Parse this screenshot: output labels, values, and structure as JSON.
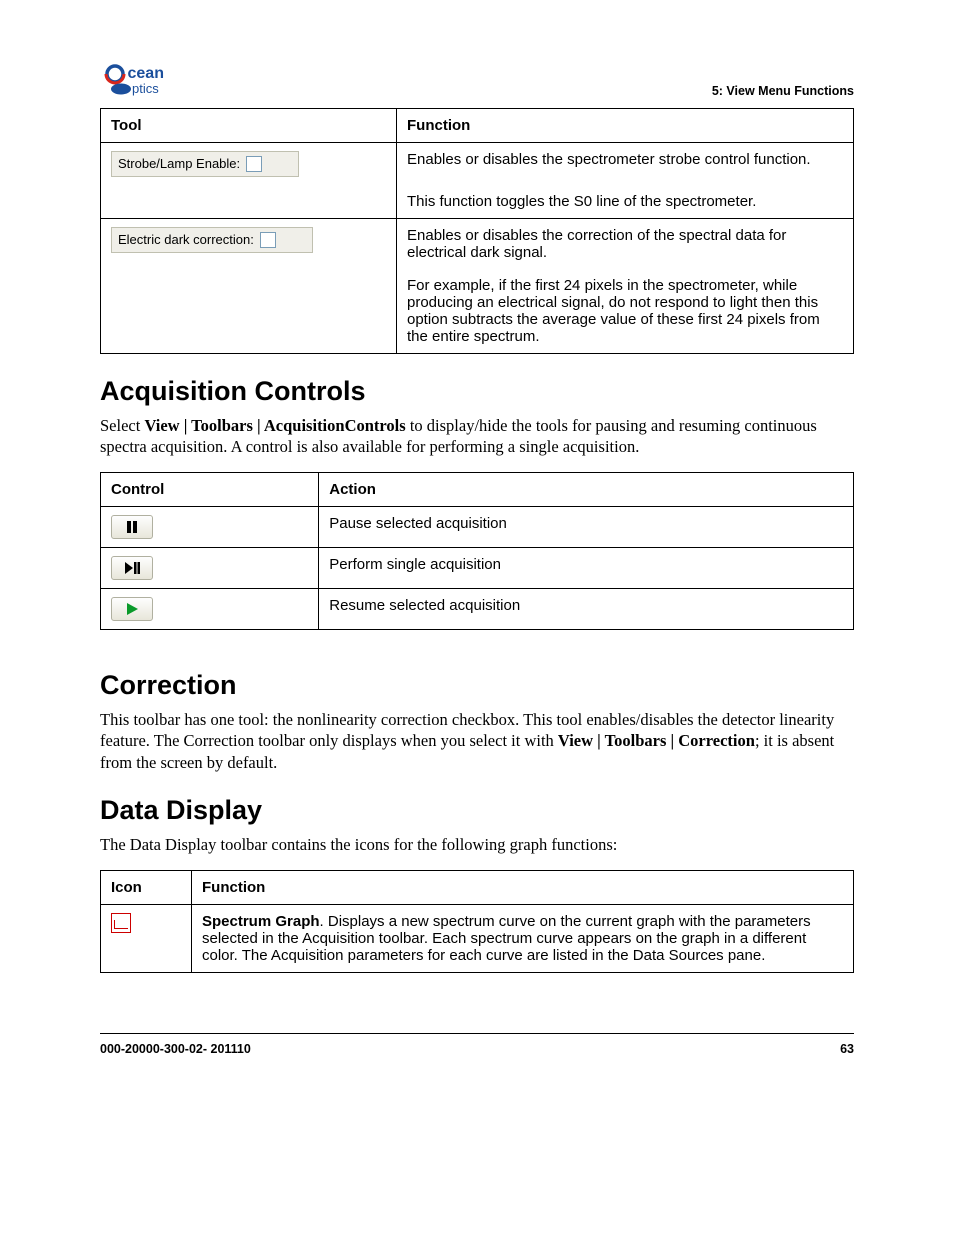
{
  "header": {
    "logo_top": "Ocean",
    "logo_bottom": "Optics",
    "right": "5: View Menu Functions"
  },
  "table1": {
    "headers": [
      "Tool",
      "Function"
    ],
    "rows": [
      {
        "tool_label": "Strobe/Lamp Enable:",
        "func1": "Enables or disables the spectrometer strobe control function.",
        "func2": "This function toggles the S0 line of the spectrometer."
      },
      {
        "tool_label": "Electric dark correction:",
        "func1": "Enables or disables the correction of the spectral data for electrical dark signal.",
        "func2": "For example, if the first 24 pixels in the spectrometer, while producing an electrical signal, do not respond to light then this option subtracts the average value of these first 24 pixels from the entire spectrum."
      }
    ]
  },
  "sections": {
    "acq": {
      "title": "Acquisition Controls",
      "intro_pre": "Select ",
      "intro_bold": "View | Toolbars | AcquisitionControls",
      "intro_post": " to display/hide the tools for pausing and resuming continuous spectra acquisition. A control is also available for performing a single acquisition.",
      "table": {
        "headers": [
          "Control",
          "Action"
        ],
        "rows": [
          {
            "icon": "pause",
            "action": "Pause selected acquisition"
          },
          {
            "icon": "single-step",
            "action": "Perform single acquisition"
          },
          {
            "icon": "play",
            "action": "Resume selected acquisition"
          }
        ]
      }
    },
    "corr": {
      "title": "Correction",
      "body_pre": "This toolbar has one tool: the nonlinearity correction checkbox. This tool enables/disables the detector linearity feature. The Correction toolbar only displays when you select it with ",
      "body_bold": "View | Toolbars | Correction",
      "body_post": "; it is absent from the screen by default."
    },
    "dd": {
      "title": "Data Display",
      "intro": "The Data Display toolbar contains the icons for the following graph functions:",
      "table": {
        "headers": [
          "Icon",
          "Function"
        ],
        "row1": {
          "bold": "Spectrum Graph",
          "rest": ". Displays a new spectrum curve on the current graph with the parameters selected in the Acquisition toolbar. Each spectrum curve appears on the graph in a different color. The Acquisition parameters for each curve are listed in the Data Sources pane."
        }
      }
    }
  },
  "footer": {
    "left": "000-20000-300-02- 201110",
    "right": "63"
  }
}
